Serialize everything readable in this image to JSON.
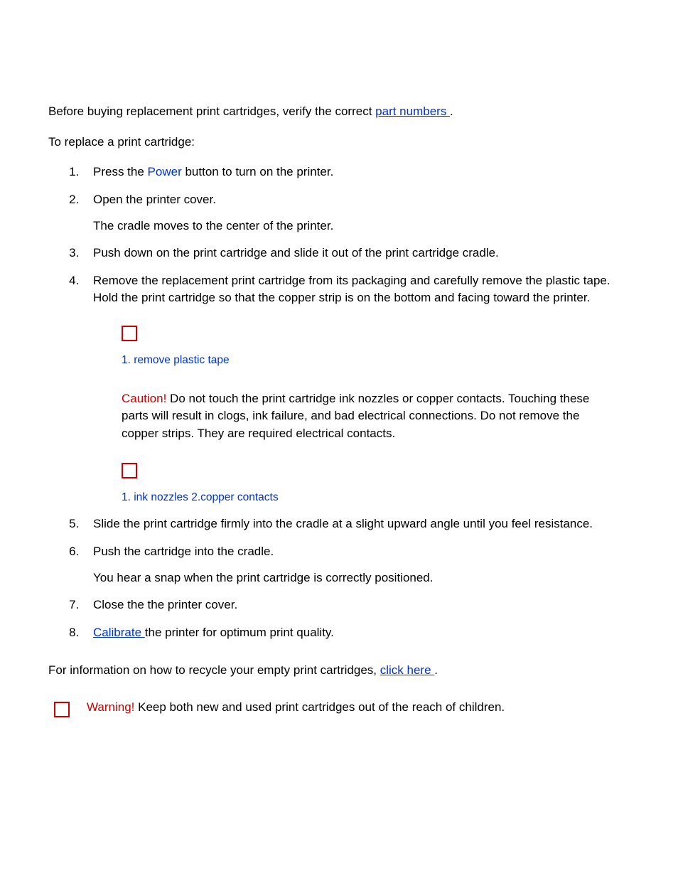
{
  "intro": {
    "before": "Before buying replacement print cartridges, verify the correct ",
    "link_part_numbers": "part numbers ",
    "after": "."
  },
  "lead": "To replace a print cartridge:",
  "steps": {
    "s1_pre": "Press the ",
    "s1_power": "Power",
    "s1_post": " button to turn on the printer.",
    "s2": "Open the printer cover.",
    "s2_sub": "The cradle moves to the center of the printer.",
    "s3": "Push down on the print cartridge and slide it out of the print cartridge cradle.",
    "s4": "Remove the replacement print cartridge from its packaging and carefully remove the plastic tape. Hold the print cartridge so that the copper strip is on the bottom and facing toward the printer.",
    "fig1_caption": "1. remove plastic tape",
    "caution_label": "Caution!",
    "caution_text": "   Do not touch the print cartridge ink nozzles or copper contacts. Touching these parts will result in clogs, ink failure, and bad electrical connections. Do not remove the copper strips. They are required electrical contacts.",
    "fig2_caption": "1. ink nozzles 2.copper contacts",
    "s5": "Slide the print cartridge firmly into the cradle at a slight upward angle until you feel resistance.",
    "s6": "Push the cartridge into the cradle.",
    "s6_sub": "You hear a snap when the print cartridge is correctly positioned.",
    "s7": "Close the the printer cover.",
    "s8_link": "Calibrate ",
    "s8_post": "the printer for optimum print quality."
  },
  "recycle": {
    "pre": "For information on how to recycle your empty print cartridges, ",
    "link": "click here ",
    "post": "."
  },
  "warning": {
    "label": "Warning!",
    "text": "   Keep both new and used print cartridges out of the reach of children."
  }
}
